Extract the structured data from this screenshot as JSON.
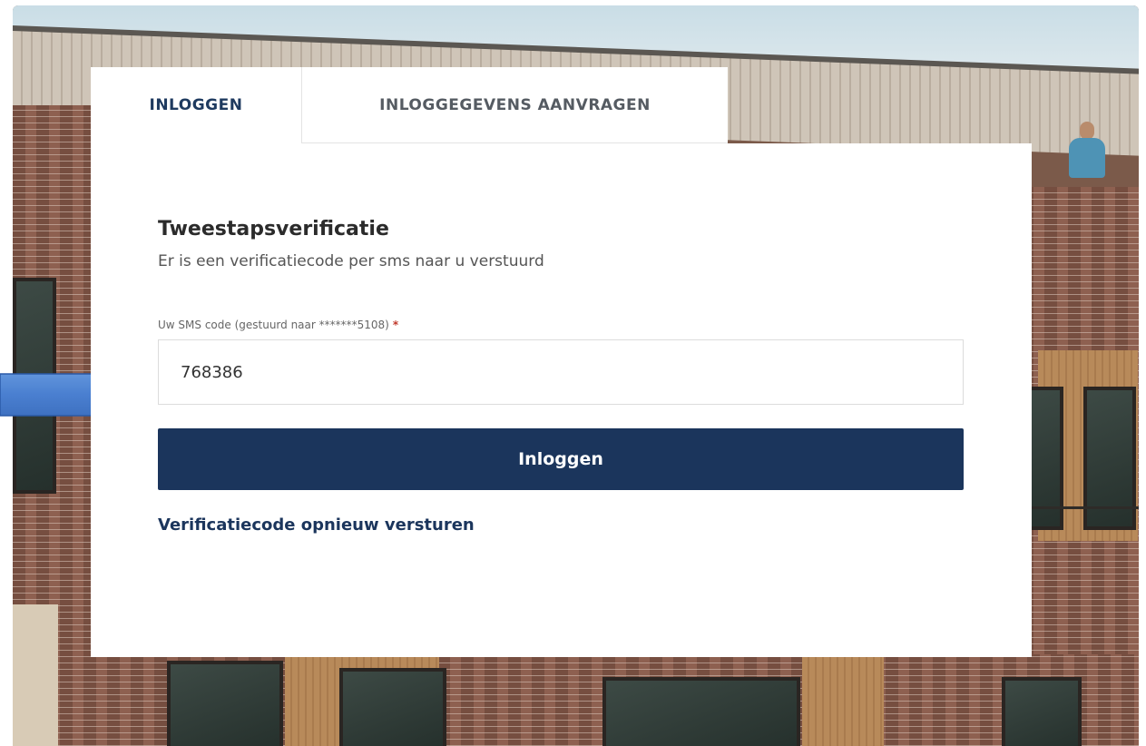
{
  "tabs": {
    "login": "INLOGGEN",
    "request_credentials": "INLOGGEGEVENS AANVRAGEN"
  },
  "form": {
    "title": "Tweestapsverificatie",
    "subtitle": "Er is een verificatiecode per sms naar u verstuurd",
    "sms_label": "Uw SMS code (gestuurd naar *******5108)",
    "required_marker": "*",
    "sms_value": "768386",
    "submit_label": "Inloggen",
    "resend_link": "Verificatiecode opnieuw versturen"
  },
  "colors": {
    "primary": "#1b355c",
    "arrow": "#4a7fd0",
    "required": "#c0392b"
  },
  "icons": {
    "pointer": "right-arrow-icon"
  }
}
